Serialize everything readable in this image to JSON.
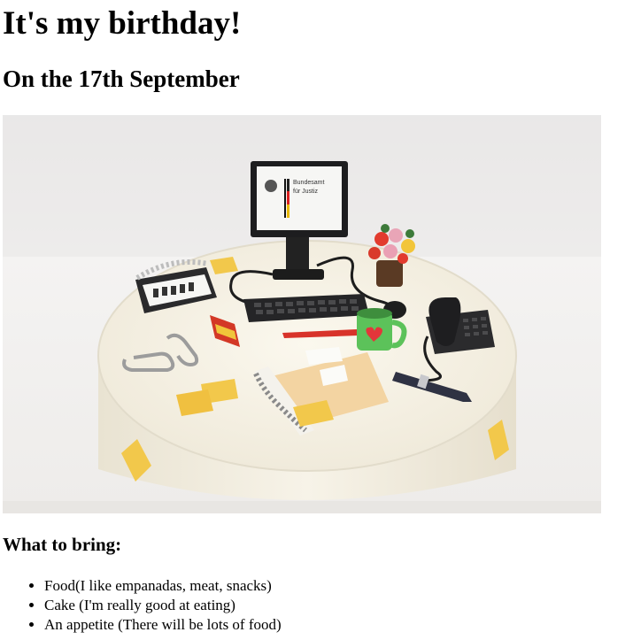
{
  "page": {
    "title": "It's my birthday!",
    "subtitle": "On the 17th September",
    "bring_heading": "What to bring:",
    "items": [
      "Food(I like empanadas, meat, snacks)",
      "Cake (I'm really good at eating)",
      "An appetite (There will be lots of food)"
    ]
  },
  "photo": {
    "monitor_text_line1": "Bundesamt",
    "monitor_text_line2": "für Justiz"
  },
  "colors": {
    "text": "#000000",
    "background": "#ffffff",
    "cake_fondant": "#f3efe3"
  }
}
